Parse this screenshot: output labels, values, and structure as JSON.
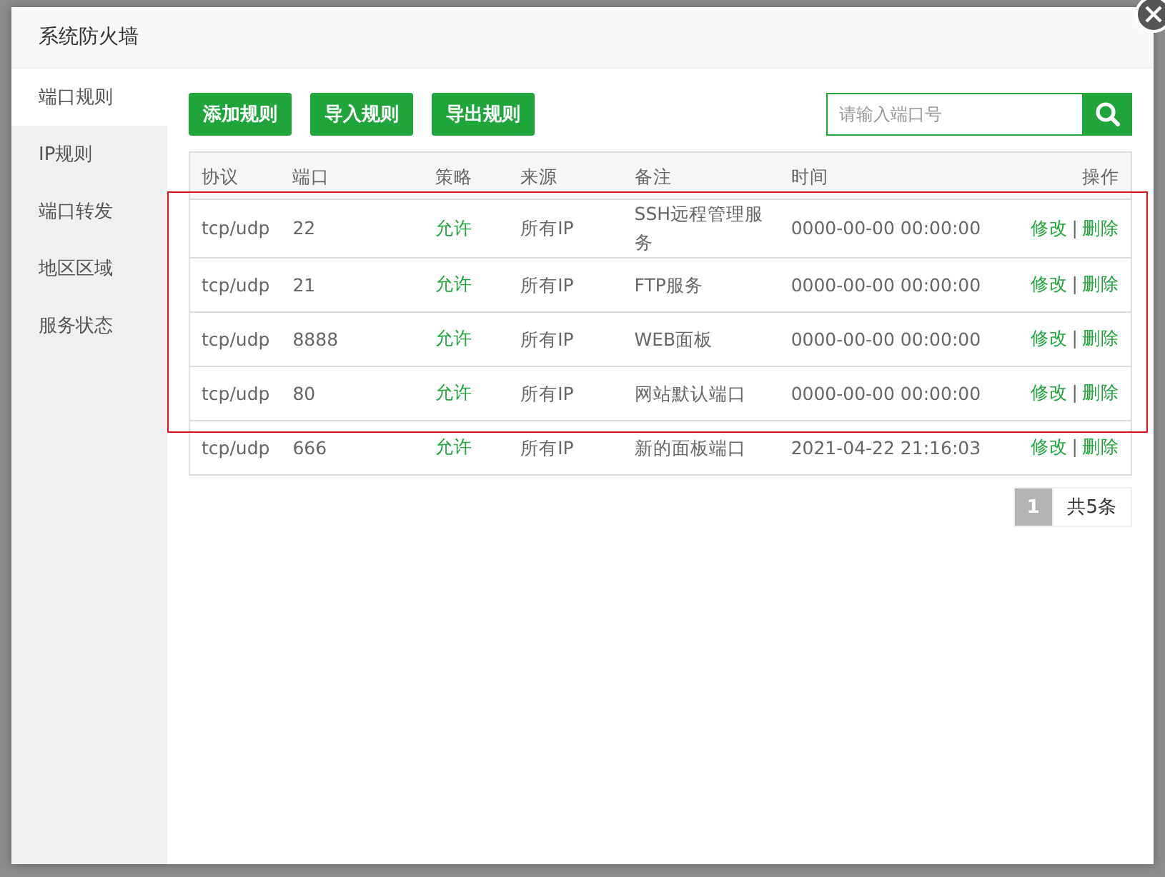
{
  "dialog": {
    "title": "系统防火墙"
  },
  "sidebar": {
    "items": [
      {
        "label": "端口规则",
        "selected": true
      },
      {
        "label": "IP规则",
        "selected": false
      },
      {
        "label": "端口转发",
        "selected": false
      },
      {
        "label": "地区区域",
        "selected": false
      },
      {
        "label": "服务状态",
        "selected": false
      }
    ]
  },
  "toolbar": {
    "buttons": [
      "添加规则",
      "导入规则",
      "导出规则"
    ],
    "search": {
      "placeholder": "请输入端口号"
    }
  },
  "table": {
    "columns": [
      "协议",
      "端口",
      "策略",
      "来源",
      "备注",
      "时间",
      "操作"
    ],
    "rows": [
      {
        "protocol": "tcp/udp",
        "port": "22",
        "policy": "允许",
        "source": "所有IP",
        "note": "SSH远程管理服务",
        "time": "0000-00-00 00:00:00",
        "actions": [
          "修改",
          "删除"
        ]
      },
      {
        "protocol": "tcp/udp",
        "port": "21",
        "policy": "允许",
        "source": "所有IP",
        "note": "FTP服务",
        "time": "0000-00-00 00:00:00",
        "actions": [
          "修改",
          "删除"
        ]
      },
      {
        "protocol": "tcp/udp",
        "port": "8888",
        "policy": "允许",
        "source": "所有IP",
        "note": "WEB面板",
        "time": "0000-00-00 00:00:00",
        "actions": [
          "修改",
          "删除"
        ]
      },
      {
        "protocol": "tcp/udp",
        "port": "80",
        "policy": "允许",
        "source": "所有IP",
        "note": "网站默认端口",
        "time": "0000-00-00 00:00:00",
        "actions": [
          "修改",
          "删除"
        ]
      },
      {
        "protocol": "tcp/udp",
        "port": "666",
        "policy": "允许",
        "source": "所有IP",
        "note": "新的面板端口",
        "time": "2021-04-22 21:16:03",
        "actions": [
          "修改",
          "删除"
        ]
      }
    ],
    "action_separator": "|"
  },
  "pagination": {
    "pages": [
      {
        "label": "1",
        "selected": true
      }
    ],
    "total": "共5条"
  }
}
